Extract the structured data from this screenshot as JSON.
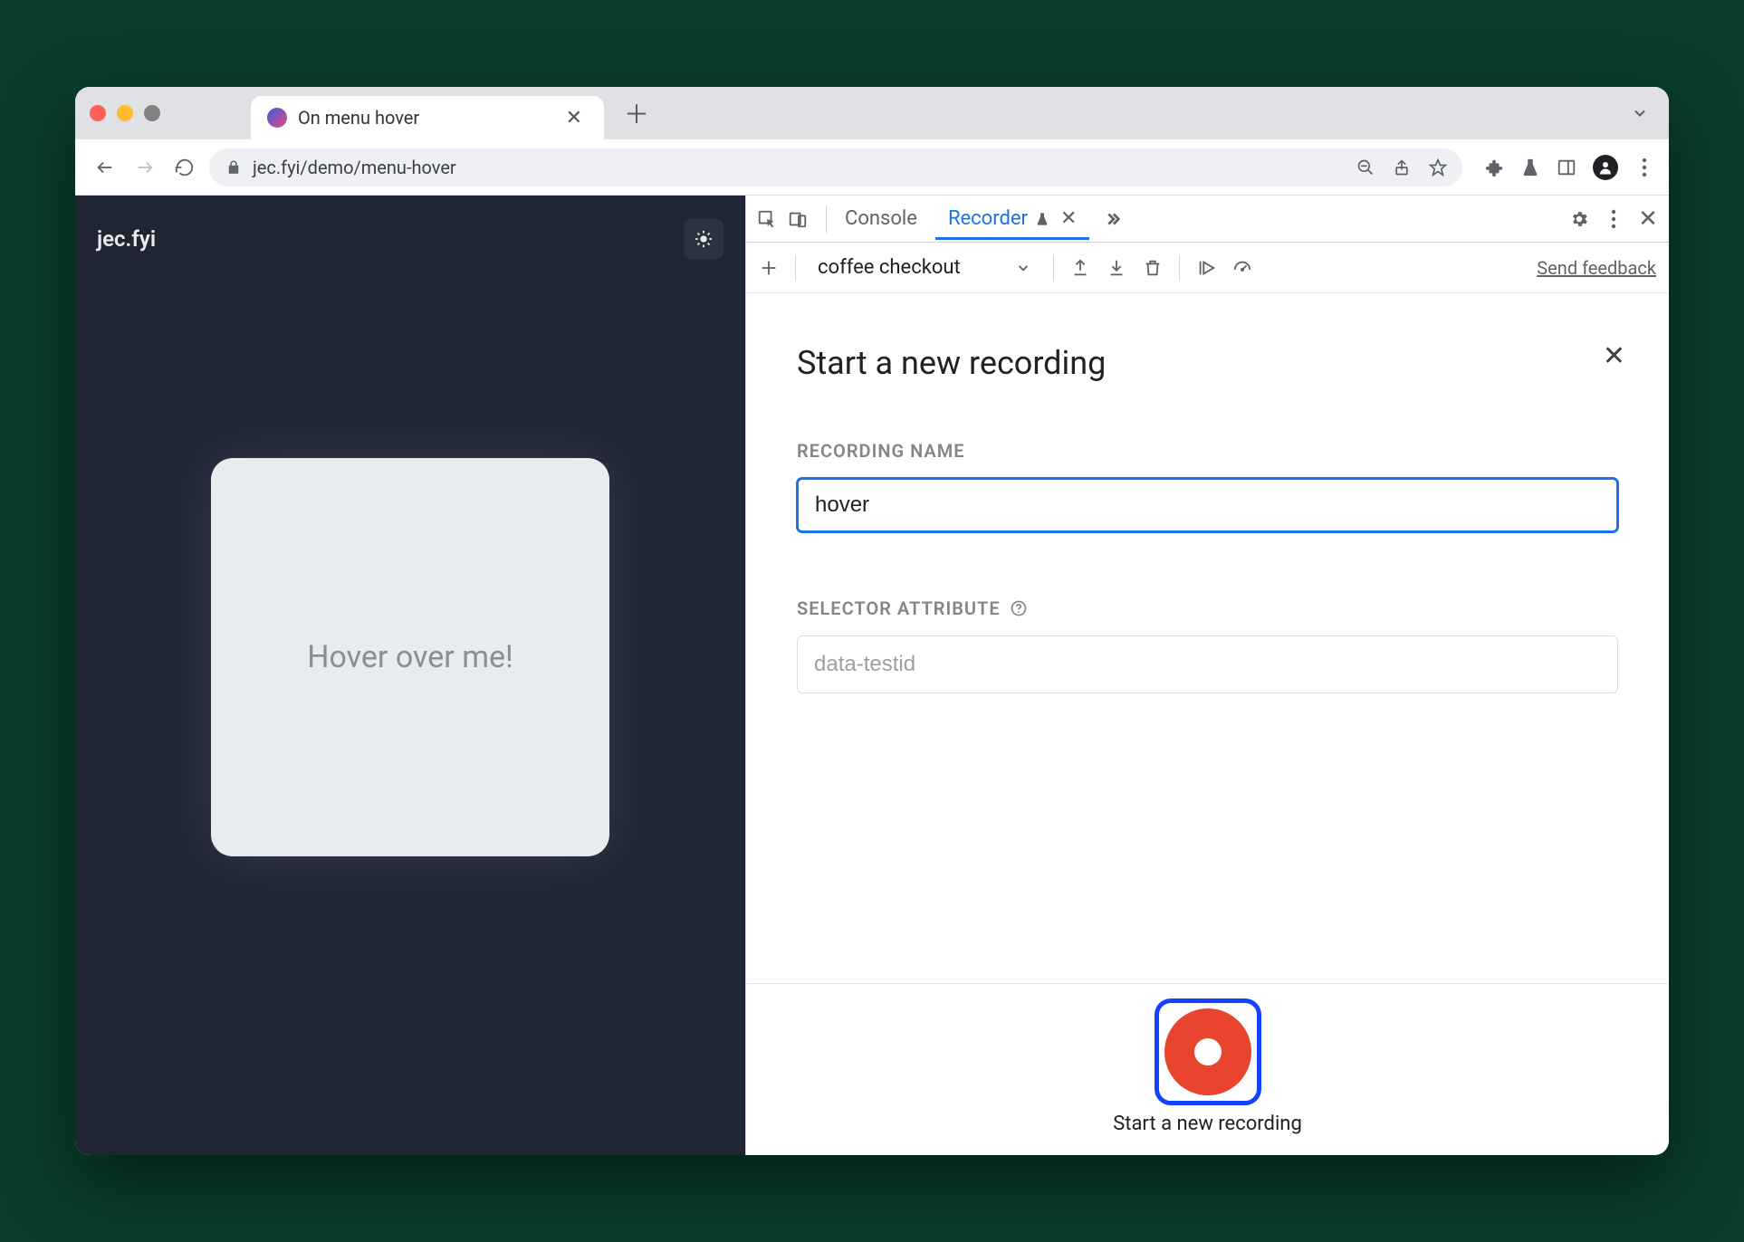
{
  "browser": {
    "tab_title": "On menu hover",
    "url": "jec.fyi/demo/menu-hover"
  },
  "page": {
    "brand": "jec.fyi",
    "card_text": "Hover over me!"
  },
  "devtools": {
    "tabs": {
      "console": "Console",
      "recorder": "Recorder"
    },
    "subbar": {
      "recording_select": "coffee checkout",
      "feedback": "Send feedback"
    },
    "panel": {
      "title": "Start a new recording",
      "recording_name_label": "RECORDING NAME",
      "recording_name_value": "hover",
      "selector_label": "SELECTOR ATTRIBUTE",
      "selector_placeholder": "data-testid",
      "record_label": "Start a new recording"
    }
  }
}
